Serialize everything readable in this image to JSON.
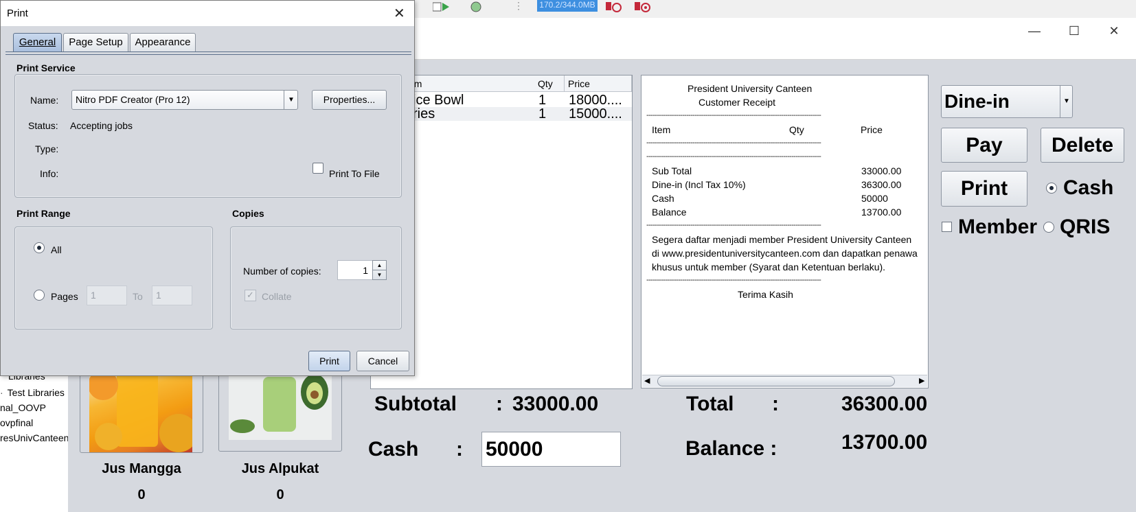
{
  "ide": {
    "memory": "170.2/344.0MB",
    "tree_items": [
      "Libraries",
      "Test Libraries",
      "nal_OOVP",
      "ovpfinal",
      "resUnivCanteen"
    ]
  },
  "order_table": {
    "headers": [
      "em",
      "Qty",
      "Price"
    ],
    "rows": [
      {
        "item": "ice Bowl",
        "qty": "1",
        "price": "18000...."
      },
      {
        "item": "ries",
        "qty": "1",
        "price": "15000...."
      }
    ]
  },
  "receipt": {
    "title": "President University Canteen",
    "subtitle": "Customer Receipt",
    "separator": "-----------------------------------------------------------------------------------",
    "col_item": "Item",
    "col_qty": "Qty",
    "col_price": "Price",
    "rows": [
      {
        "label": "Sub Total",
        "value": "33000.00"
      },
      {
        "label": "Dine-in (Incl Tax 10%)",
        "value": "36300.00"
      },
      {
        "label": "Cash",
        "value": "50000"
      },
      {
        "label": "Balance",
        "value": "13700.00"
      }
    ],
    "promo": [
      "Segera daftar menjadi member President University Canteen",
      "di www.presidentuniversitycanteen.com dan dapatkan penawa",
      "khusus untuk member (Syarat dan Ketentuan berlaku)."
    ],
    "thanks": "Terima Kasih"
  },
  "controls": {
    "order_type": "Dine-in",
    "pay": "Pay",
    "delete": "Delete",
    "print": "Print",
    "cash": "Cash",
    "member": "Member",
    "qris": "QRIS",
    "payment_selected": "Cash"
  },
  "totals": {
    "subtotal_label": "Subtotal",
    "subtotal_value": "33000.00",
    "cash_label": "Cash",
    "cash_value": "50000",
    "total_label": "Total",
    "total_value": "36300.00",
    "balance_label": "Balance :",
    "balance_value": "13700.00",
    "colon": ":"
  },
  "products": [
    {
      "name": "Jus Mangga",
      "count": "0"
    },
    {
      "name": "Jus Alpukat",
      "count": "0"
    }
  ],
  "print_dialog": {
    "title": "Print",
    "tabs": [
      "General",
      "Page Setup",
      "Appearance"
    ],
    "print_service": {
      "heading": "Print Service",
      "name_label": "Name:",
      "printer": "Nitro PDF Creator (Pro 12)",
      "properties": "Properties...",
      "status_label": "Status:",
      "status_value": "Accepting jobs",
      "type_label": "Type:",
      "info_label": "Info:",
      "print_to_file": "Print To File"
    },
    "print_range": {
      "heading": "Print Range",
      "all": "All",
      "pages": "Pages",
      "from": "1",
      "to_label": "To",
      "to": "1"
    },
    "copies": {
      "heading": "Copies",
      "number_label": "Number of copies:",
      "number": "1",
      "collate": "Collate"
    },
    "print_button": "Print",
    "cancel_button": "Cancel"
  }
}
